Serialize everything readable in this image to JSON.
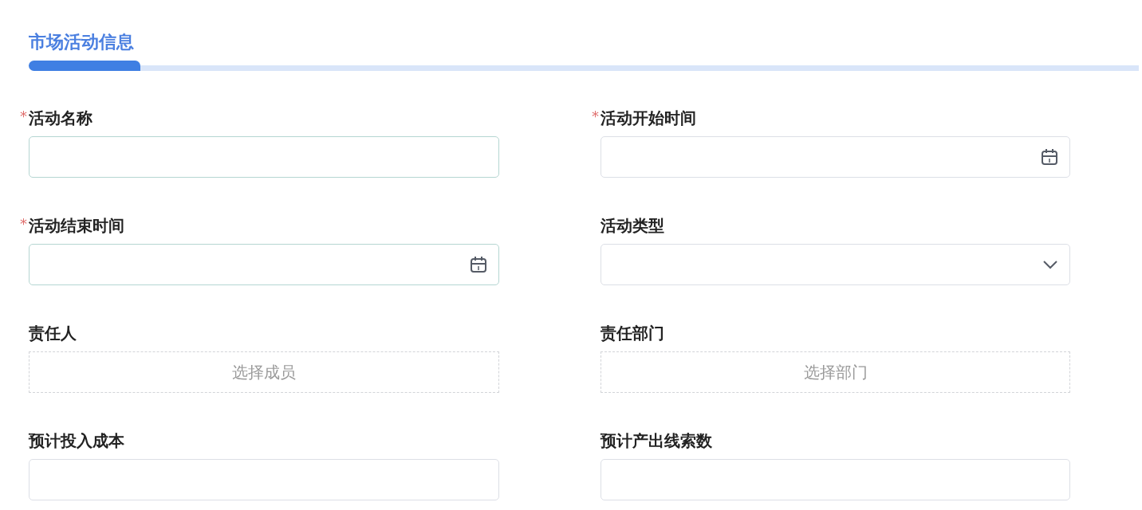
{
  "section": {
    "title": "市场活动信息"
  },
  "fields": [
    {
      "label": "活动名称",
      "required_mark": "*",
      "kind": "text",
      "highlighted": true
    },
    {
      "label": "活动开始时间",
      "required_mark": "*",
      "kind": "date",
      "highlighted": false
    },
    {
      "label": "活动结束时间",
      "required_mark": "*",
      "kind": "date",
      "highlighted": true
    },
    {
      "label": "活动类型",
      "kind": "select",
      "highlighted": false
    },
    {
      "label": "责任人",
      "kind": "picker",
      "highlighted": false,
      "placeholder": "选择成员"
    },
    {
      "label": "责任部门",
      "kind": "picker",
      "highlighted": false,
      "placeholder": "选择部门"
    },
    {
      "label": "预计投入成本",
      "kind": "text",
      "highlighted": false
    },
    {
      "label": "预计产出线索数",
      "kind": "text",
      "highlighted": false
    }
  ]
}
